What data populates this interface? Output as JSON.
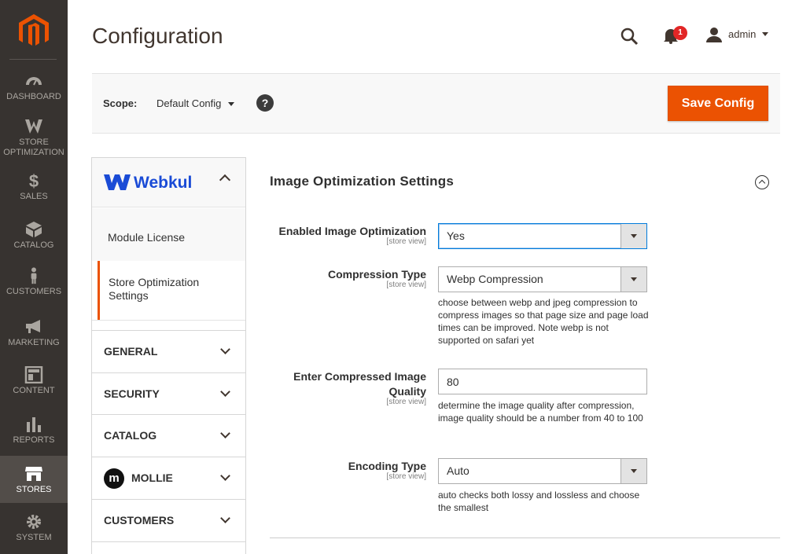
{
  "sidebar": {
    "logo": "magento-logo",
    "items": [
      {
        "label": "DASHBOARD",
        "icon": "dashboard-icon"
      },
      {
        "label": "STORE OPTIMIZATION",
        "icon": "webkul-icon"
      },
      {
        "label": "SALES",
        "icon": "dollar-icon"
      },
      {
        "label": "CATALOG",
        "icon": "box-icon"
      },
      {
        "label": "CUSTOMERS",
        "icon": "person-icon"
      },
      {
        "label": "MARKETING",
        "icon": "megaphone-icon"
      },
      {
        "label": "CONTENT",
        "icon": "layout-icon"
      },
      {
        "label": "REPORTS",
        "icon": "bar-chart-icon"
      },
      {
        "label": "STORES",
        "icon": "store-icon",
        "active": true
      },
      {
        "label": "SYSTEM",
        "icon": "gear-icon"
      }
    ]
  },
  "header": {
    "title": "Configuration",
    "notifications_count": "1",
    "user": "admin"
  },
  "scope": {
    "label": "Scope:",
    "value": "Default Config",
    "help": "?"
  },
  "actions": {
    "save": "Save Config"
  },
  "config_tabs": {
    "brand": "Webkul",
    "items": [
      "Module License",
      "Store Optimization Settings"
    ],
    "active_index": 1,
    "sections": [
      "GENERAL",
      "SECURITY",
      "CATALOG",
      "MOLLIE",
      "CUSTOMERS"
    ]
  },
  "fieldset": {
    "title": "Image Optimization Settings",
    "fields": [
      {
        "label": "Enabled Image Optimization",
        "scope": "[store view]",
        "value": "Yes",
        "type": "select"
      },
      {
        "label": "Compression Type",
        "scope": "[store view]",
        "value": "Webp Compression",
        "type": "select",
        "note": "choose between webp and jpeg compression to compress images so that page size and page load times can be improved. Note webp is not supported on safari yet"
      },
      {
        "label": "Enter Compressed Image Quality",
        "scope": "[store view]",
        "value": "80",
        "type": "text",
        "note": "determine the image quality after compression, image quality should be a number from 40 to 100"
      },
      {
        "label": "Encoding Type",
        "scope": "[store view]",
        "value": "Auto",
        "type": "select",
        "note": "auto checks both lossy and lossless and choose the smallest"
      }
    ]
  },
  "colors": {
    "sidebar_bg": "#373330",
    "accent": "#eb5202",
    "webkul_blue": "#1a4bd6",
    "badge": "#e22626"
  }
}
